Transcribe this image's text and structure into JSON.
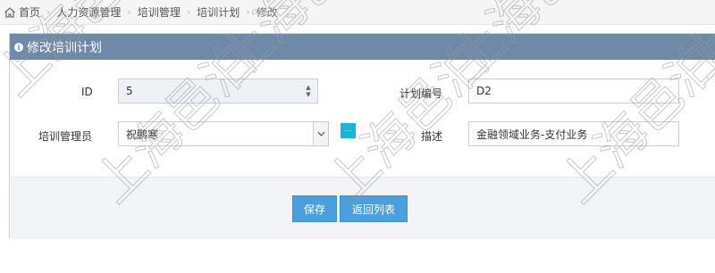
{
  "breadcrumb": {
    "items": [
      "首页",
      "人力资源管理",
      "培训管理",
      "培训计划"
    ],
    "current": "修改",
    "separator": "›"
  },
  "panel": {
    "title": "修改培训计划"
  },
  "form": {
    "id_label": "ID",
    "id_value": "5",
    "plan_no_label": "计划编号",
    "plan_no_value": "D2",
    "manager_label": "培训管理员",
    "manager_value": "祝鹏寒",
    "lookup_label": "...",
    "desc_label": "描述",
    "desc_value": "金融领域业务-支付业务"
  },
  "buttons": {
    "save": "保存",
    "back": "返回列表"
  },
  "watermark": {
    "text": "上海邑泊"
  },
  "colors": {
    "header_bg": "#6f8aa9",
    "button": "#4a9fdc",
    "lookup": "#1ab4d8",
    "footer_bg": "#f2f4f7"
  },
  "icons": [
    "home-icon",
    "info-icon",
    "spinner-icon",
    "chevron-down-icon"
  ]
}
